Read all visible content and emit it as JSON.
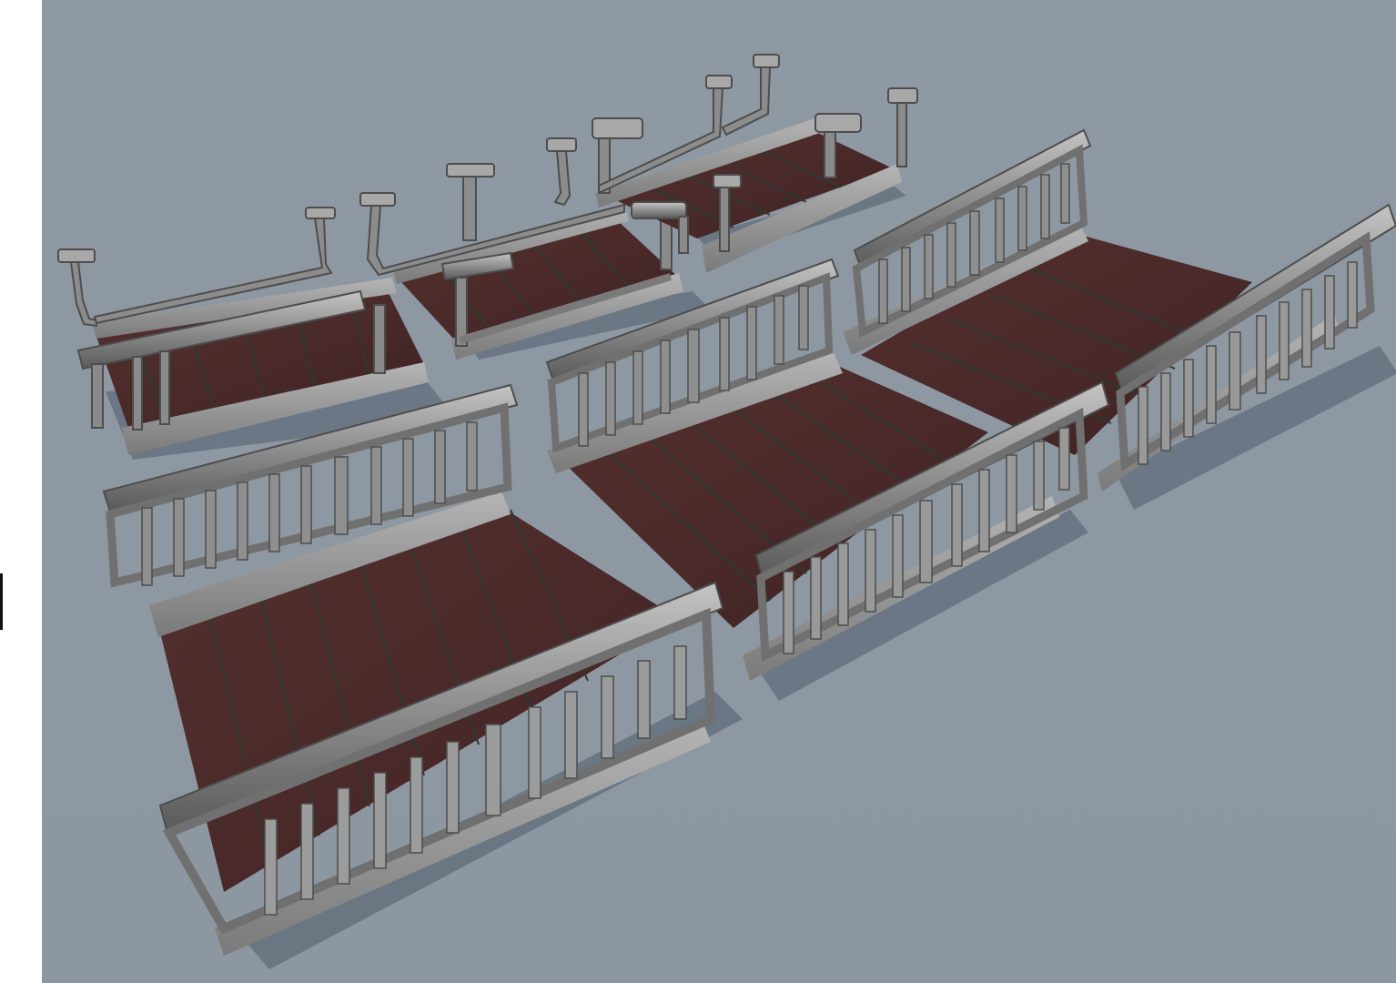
{
  "scene": {
    "background": "#8e98a2",
    "deck_color": "#4a2a2a",
    "deck_seam_color": "#2a3a30",
    "rail_color": "#9a9a9a",
    "rail_dark": "#5c5c5c",
    "shadow_color": "#4a5868",
    "assets": [
      {
        "name": "bridge-module-short-open-rail"
      },
      {
        "name": "bridge-module-medium-open-rail"
      },
      {
        "name": "bridge-module-narrow-open-rail"
      },
      {
        "name": "bridge-module-wide-balustrade-front"
      },
      {
        "name": "bridge-module-wide-balustrade-center"
      },
      {
        "name": "bridge-module-wide-balustrade-right"
      }
    ]
  }
}
